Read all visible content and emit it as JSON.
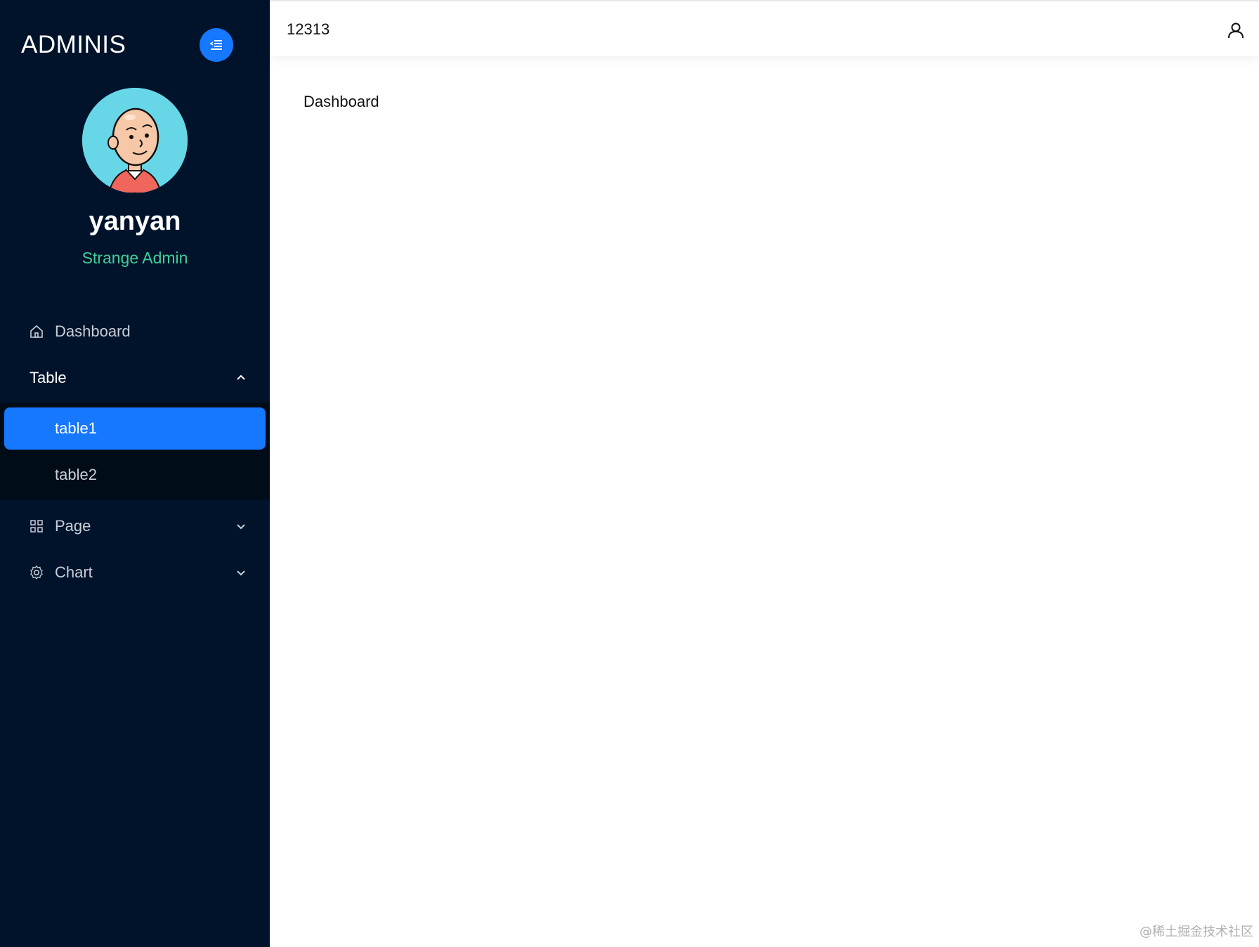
{
  "sidebar": {
    "brand": "ADMINIS",
    "profile": {
      "name": "yanyan",
      "role": "Strange Admin"
    },
    "menu": [
      {
        "label": "Dashboard",
        "icon": "home-icon"
      },
      {
        "label": "Table",
        "icon": "",
        "expanded": true,
        "children": [
          {
            "label": "table1",
            "active": true
          },
          {
            "label": "table2",
            "active": false
          }
        ]
      },
      {
        "label": "Page",
        "icon": "grid-icon"
      },
      {
        "label": "Chart",
        "icon": "gear-icon"
      }
    ]
  },
  "header": {
    "title": "12313",
    "user_icon": "user-icon"
  },
  "main": {
    "title": "Dashboard"
  },
  "watermark": "@稀土掘金技术社区",
  "colors": {
    "sidebar_bg": "#00132b",
    "submenu_bg": "#000c17",
    "accent": "#1677ff",
    "role_text": "#3fcf9a",
    "avatar_bg": "#67d7e8"
  }
}
